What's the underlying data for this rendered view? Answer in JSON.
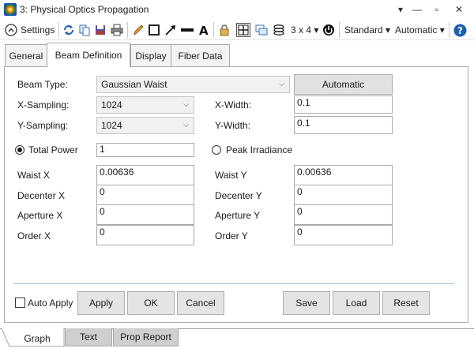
{
  "window": {
    "title": "3: Physical Optics Propagation",
    "controls": {
      "menu": "▾",
      "minimize": "—",
      "restore": "▫",
      "close": "✕"
    }
  },
  "toolbar": {
    "settings_label": "Settings",
    "grid_label": "3 x 4 ▾",
    "standard_label": "Standard ▾",
    "automatic_label": "Automatic ▾"
  },
  "tabs": [
    {
      "label": "General"
    },
    {
      "label": "Beam Definition"
    },
    {
      "label": "Display"
    },
    {
      "label": "Fiber Data"
    }
  ],
  "form": {
    "beam_type_label": "Beam Type:",
    "beam_type_value": "Gaussian Waist",
    "automatic_button": "Automatic",
    "x_sampling_label": "X-Sampling:",
    "x_sampling_value": "1024",
    "y_sampling_label": "Y-Sampling:",
    "y_sampling_value": "1024",
    "x_width_label": "X-Width:",
    "x_width_value": "0.1",
    "y_width_label": "Y-Width:",
    "y_width_value": "0.1",
    "total_power_label": "Total Power",
    "total_power_value": "1",
    "total_power_selected": true,
    "peak_irradiance_label": "Peak Irradiance",
    "peak_irradiance_selected": false,
    "waist_x_label": "Waist X",
    "waist_x_value": "0.00636",
    "waist_y_label": "Waist Y",
    "waist_y_value": "0.00636",
    "decenter_x_label": "Decenter X",
    "decenter_x_value": "0",
    "decenter_y_label": "Decenter Y",
    "decenter_y_value": "0",
    "aperture_x_label": "Aperture X",
    "aperture_x_value": "0",
    "aperture_y_label": "Aperture Y",
    "aperture_y_value": "0",
    "order_x_label": "Order X",
    "order_x_value": "0",
    "order_y_label": "Order Y",
    "order_y_value": "0"
  },
  "actions": {
    "auto_apply_label": "Auto Apply",
    "auto_apply_checked": false,
    "apply": "Apply",
    "ok": "OK",
    "cancel": "Cancel",
    "save": "Save",
    "load": "Load",
    "reset": "Reset"
  },
  "bottom_tabs": [
    {
      "label": "Graph"
    },
    {
      "label": "Text"
    },
    {
      "label": "Prop Report"
    }
  ],
  "colors": {
    "border": "#a8a8a8",
    "button": "#e4e4e4",
    "accent": "#1b5fb5"
  }
}
